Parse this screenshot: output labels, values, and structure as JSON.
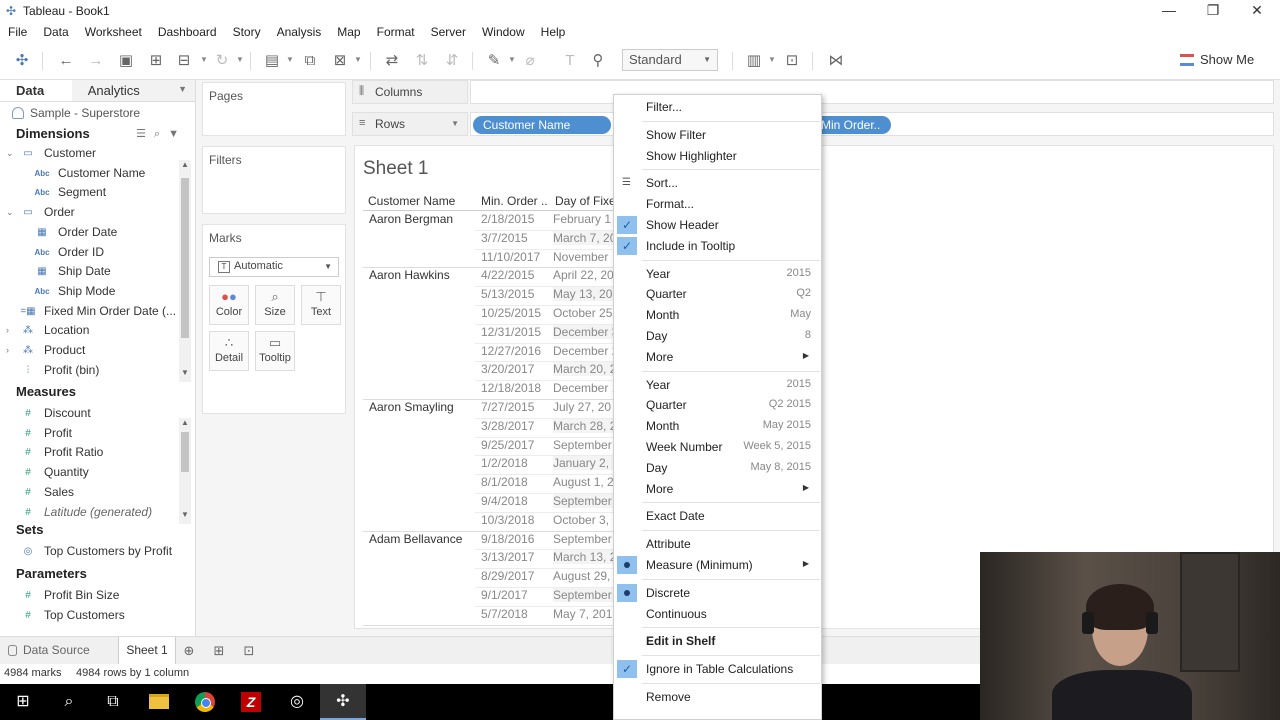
{
  "window": {
    "title": "Tableau - Book1"
  },
  "menubar": [
    "File",
    "Data",
    "Worksheet",
    "Dashboard",
    "Story",
    "Analysis",
    "Map",
    "Format",
    "Server",
    "Window",
    "Help"
  ],
  "toolbar": {
    "fit_select": "Standard",
    "show_me": "Show Me"
  },
  "left_pane": {
    "tabs": {
      "data": "Data",
      "analytics": "Analytics"
    },
    "data_source": "Sample - Superstore",
    "dimensions_title": "Dimensions",
    "dimensions": [
      {
        "label": "Customer",
        "icon": "folder-icon",
        "expanded": true,
        "level": 0
      },
      {
        "label": "Customer Name",
        "icon": "abc-icon",
        "level": 1
      },
      {
        "label": "Segment",
        "icon": "abc-icon",
        "level": 1
      },
      {
        "label": "Order",
        "icon": "folder-icon",
        "expanded": true,
        "level": 0
      },
      {
        "label": "Order Date",
        "icon": "calendar-icon",
        "level": 1
      },
      {
        "label": "Order ID",
        "icon": "abc-icon",
        "level": 1
      },
      {
        "label": "Ship Date",
        "icon": "calendar-icon",
        "level": 1
      },
      {
        "label": "Ship Mode",
        "icon": "abc-icon",
        "level": 1
      },
      {
        "label": "Fixed Min Order Date (...",
        "icon": "calc-date-icon",
        "level": 0
      },
      {
        "label": "Location",
        "icon": "hierarchy-icon",
        "level": 0,
        "collapsed": true
      },
      {
        "label": "Product",
        "icon": "hierarchy-icon",
        "level": 0,
        "collapsed": true
      },
      {
        "label": "Profit (bin)",
        "icon": "bin-icon",
        "level": 0
      }
    ],
    "measures_title": "Measures",
    "measures": [
      {
        "label": "Discount"
      },
      {
        "label": "Profit"
      },
      {
        "label": "Profit Ratio"
      },
      {
        "label": "Quantity"
      },
      {
        "label": "Sales"
      },
      {
        "label": "Latitude (generated)",
        "italic": true
      }
    ],
    "sets_title": "Sets",
    "sets": [
      "Top Customers by Profit"
    ],
    "parameters_title": "Parameters",
    "parameters": [
      "Profit Bin Size",
      "Top Customers"
    ]
  },
  "cards": {
    "pages": "Pages",
    "filters": "Filters",
    "marks": "Marks",
    "mark_type": "Automatic",
    "mark_buttons": [
      "Color",
      "Size",
      "Text",
      "Detail",
      "Tooltip"
    ]
  },
  "shelves": {
    "columns_label": "Columns",
    "rows_label": "Rows",
    "row_pills": [
      "Customer Name",
      "Min Order.."
    ]
  },
  "sheet": {
    "title": "Sheet 1",
    "headers": [
      "Customer Name",
      "Min. Order ..",
      "Day of Fixe"
    ],
    "groups": [
      {
        "name": "Aaron Bergman",
        "rows": [
          [
            "2/18/2015",
            "February 1"
          ],
          [
            "3/7/2015",
            "March 7, 20"
          ],
          [
            "11/10/2017",
            "November"
          ]
        ]
      },
      {
        "name": "Aaron Hawkins",
        "rows": [
          [
            "4/22/2015",
            "April 22, 20"
          ],
          [
            "5/13/2015",
            "May 13, 20"
          ],
          [
            "10/25/2015",
            "October 25"
          ],
          [
            "12/31/2015",
            "December 3"
          ],
          [
            "12/27/2016",
            "December 2"
          ],
          [
            "3/20/2017",
            "March 20, 2"
          ],
          [
            "12/18/2018",
            "December 1"
          ]
        ]
      },
      {
        "name": "Aaron Smayling",
        "rows": [
          [
            "7/27/2015",
            "July 27, 20"
          ],
          [
            "3/28/2017",
            "March 28, 2"
          ],
          [
            "9/25/2017",
            "September"
          ],
          [
            "1/2/2018",
            "January 2,"
          ],
          [
            "8/1/2018",
            "August 1, 2"
          ],
          [
            "9/4/2018",
            "September"
          ],
          [
            "10/3/2018",
            "October 3,"
          ]
        ]
      },
      {
        "name": "Adam Bellavance",
        "rows": [
          [
            "9/18/2016",
            "September"
          ],
          [
            "3/13/2017",
            "March 13, 2"
          ],
          [
            "8/29/2017",
            "August 29,"
          ],
          [
            "9/1/2017",
            "September"
          ],
          [
            "5/7/2018",
            "May 7, 201"
          ]
        ]
      }
    ]
  },
  "context_menu": {
    "items": [
      {
        "label": "Filter..."
      },
      {
        "sep": true
      },
      {
        "label": "Show Filter"
      },
      {
        "label": "Show Highlighter"
      },
      {
        "sep": true
      },
      {
        "label": "Sort...",
        "icon": "sort-icon"
      },
      {
        "label": "Format..."
      },
      {
        "label": "Show Header",
        "checked": true
      },
      {
        "label": "Include in Tooltip",
        "checked": true
      },
      {
        "sep": true
      },
      {
        "label": "Year",
        "right": "2015"
      },
      {
        "label": "Quarter",
        "right": "Q2"
      },
      {
        "label": "Month",
        "right": "May"
      },
      {
        "label": "Day",
        "right": "8"
      },
      {
        "label": "More",
        "submenu": true
      },
      {
        "sep": true
      },
      {
        "label": "Year",
        "right": "2015"
      },
      {
        "label": "Quarter",
        "right": "Q2 2015"
      },
      {
        "label": "Month",
        "right": "May 2015"
      },
      {
        "label": "Week Number",
        "right": "Week 5, 2015"
      },
      {
        "label": "Day",
        "right": "May 8, 2015"
      },
      {
        "label": "More",
        "submenu": true
      },
      {
        "sep": true
      },
      {
        "label": "Exact Date"
      },
      {
        "sep": true
      },
      {
        "label": "Attribute"
      },
      {
        "label": "Measure (Minimum)",
        "bullet": true,
        "submenu": true
      },
      {
        "sep": true
      },
      {
        "label": "Discrete",
        "bullet": true
      },
      {
        "label": "Continuous"
      },
      {
        "sep": true
      },
      {
        "label": "Edit in Shelf",
        "bold": true
      },
      {
        "sep": true
      },
      {
        "label": "Ignore in Table Calculations",
        "checked": true
      },
      {
        "sep": true
      },
      {
        "label": "Remove"
      }
    ]
  },
  "bottom": {
    "data_source_tab": "Data Source",
    "sheet_tab": "Sheet 1",
    "status_marks": "4984 marks",
    "status_rows": "4984 rows by 1 column"
  }
}
